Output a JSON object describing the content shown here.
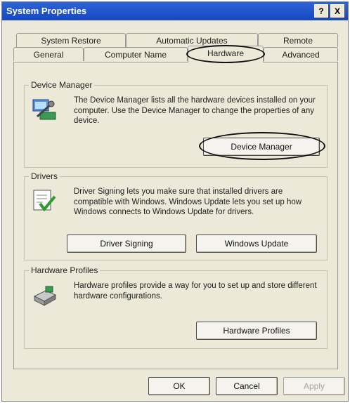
{
  "window": {
    "title": "System Properties",
    "help_label": "?",
    "close_label": "X"
  },
  "tabs": {
    "row1": [
      "System Restore",
      "Automatic Updates",
      "Remote"
    ],
    "row2": [
      "General",
      "Computer Name",
      "Hardware",
      "Advanced"
    ],
    "active": "Hardware"
  },
  "device_manager": {
    "title": "Device Manager",
    "text": "The Device Manager lists all the hardware devices installed on your computer. Use the Device Manager to change the properties of any device.",
    "button": "Device Manager"
  },
  "drivers": {
    "title": "Drivers",
    "text": "Driver Signing lets you make sure that installed drivers are compatible with Windows. Windows Update lets you set up how Windows connects to Windows Update for drivers.",
    "button_signing": "Driver Signing",
    "button_update": "Windows Update"
  },
  "hardware_profiles": {
    "title": "Hardware Profiles",
    "text": "Hardware profiles provide a way for you to set up and store different hardware configurations.",
    "button": "Hardware Profiles"
  },
  "footer": {
    "ok": "OK",
    "cancel": "Cancel",
    "apply": "Apply"
  }
}
